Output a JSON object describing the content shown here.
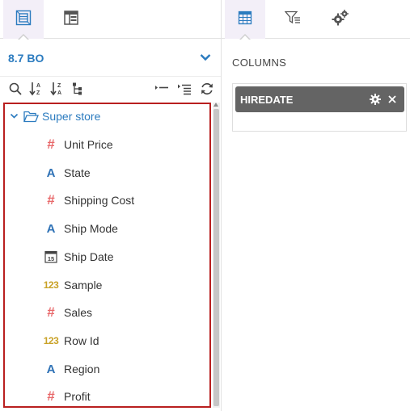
{
  "left_panel": {
    "tabs": [
      {
        "icon": "data-source-icon",
        "active": true
      },
      {
        "icon": "layout-icon",
        "active": false
      }
    ],
    "model": {
      "name": "8.7 BO",
      "chevron": "chevron-down-icon"
    },
    "toolbar": {
      "left": [
        "search-icon",
        "sort-ascending-icon",
        "sort-descending-icon",
        "hierarchy-icon"
      ],
      "right": [
        "collapse-all-icon",
        "expand-all-icon",
        "refresh-icon"
      ]
    },
    "tree": {
      "root": {
        "label": "Super store",
        "expanded": true
      },
      "fields": [
        {
          "label": "Unit Price",
          "type": "measure"
        },
        {
          "label": "State",
          "type": "string"
        },
        {
          "label": "Shipping Cost",
          "type": "measure"
        },
        {
          "label": "Ship Mode",
          "type": "string"
        },
        {
          "label": "Ship Date",
          "type": "date"
        },
        {
          "label": "Sample",
          "type": "integer"
        },
        {
          "label": "Sales",
          "type": "measure"
        },
        {
          "label": "Row Id",
          "type": "integer"
        },
        {
          "label": "Region",
          "type": "string"
        },
        {
          "label": "Profit",
          "type": "measure"
        }
      ]
    }
  },
  "right_panel": {
    "tabs": [
      {
        "icon": "table-icon",
        "active": true
      },
      {
        "icon": "filter-icon",
        "active": false
      },
      {
        "icon": "settings-icon",
        "active": false
      }
    ],
    "section_title": "COLUMNS",
    "columns": [
      {
        "label": "HIREDATE"
      }
    ]
  },
  "colors": {
    "accent": "#2b7bbf",
    "highlight_border": "#b91f1f",
    "pill_bg": "#646464",
    "measure_icon": "#e8696b",
    "string_icon": "#2f72b6",
    "integer_icon": "#c9a227"
  },
  "glyphs": {
    "measure": "#",
    "string": "A",
    "integer": "123",
    "date_day": "15"
  }
}
